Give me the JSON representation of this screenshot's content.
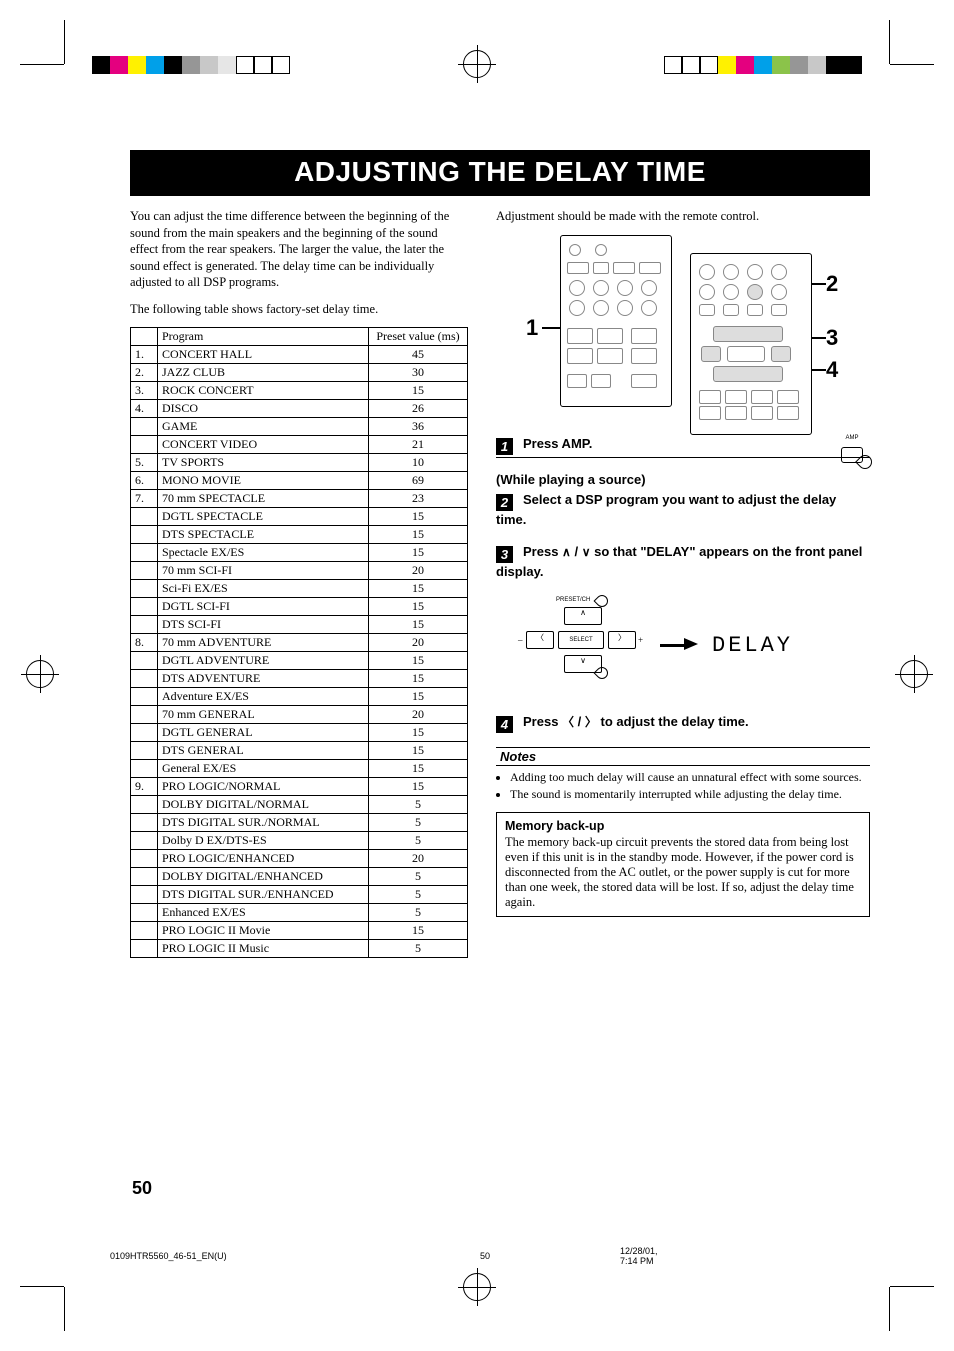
{
  "title": "ADJUSTING THE DELAY TIME",
  "intro1": "You can adjust the time difference between the beginning of the sound from the main speakers and the beginning of the sound effect from the rear speakers. The larger the value, the later the sound effect is generated. The delay time can be individually adjusted to all DSP programs.",
  "intro2": "The following table shows factory-set delay time.",
  "right_intro": "Adjustment should be made with the remote control.",
  "table": {
    "h_program": "Program",
    "h_value": "Preset value (ms)"
  },
  "rows": [
    {
      "n": "1.",
      "p": "CONCERT HALL",
      "v": "45"
    },
    {
      "n": "2.",
      "p": "JAZZ CLUB",
      "v": "30"
    },
    {
      "n": "3.",
      "p": "ROCK CONCERT",
      "v": "15"
    },
    {
      "n": "4.",
      "p": "DISCO",
      "v": "26"
    },
    {
      "n": "",
      "p": "GAME",
      "v": "36"
    },
    {
      "n": "",
      "p": "CONCERT VIDEO",
      "v": "21"
    },
    {
      "n": "5.",
      "p": "TV SPORTS",
      "v": "10"
    },
    {
      "n": "6.",
      "p": "MONO MOVIE",
      "v": "69"
    },
    {
      "n": "7.",
      "p": "70 mm SPECTACLE",
      "v": "23"
    },
    {
      "n": "",
      "p": "DGTL SPECTACLE",
      "v": "15"
    },
    {
      "n": "",
      "p": "DTS SPECTACLE",
      "v": "15"
    },
    {
      "n": "",
      "p": "Spectacle EX/ES",
      "v": "15"
    },
    {
      "n": "",
      "p": "70 mm SCI-FI",
      "v": "20"
    },
    {
      "n": "",
      "p": "Sci-Fi EX/ES",
      "v": "15"
    },
    {
      "n": "",
      "p": "DGTL SCI-FI",
      "v": "15"
    },
    {
      "n": "",
      "p": "DTS SCI-FI",
      "v": "15"
    },
    {
      "n": "8.",
      "p": "70 mm ADVENTURE",
      "v": "20"
    },
    {
      "n": "",
      "p": "DGTL ADVENTURE",
      "v": "15"
    },
    {
      "n": "",
      "p": "DTS ADVENTURE",
      "v": "15"
    },
    {
      "n": "",
      "p": "Adventure EX/ES",
      "v": "15"
    },
    {
      "n": "",
      "p": "70 mm GENERAL",
      "v": "20"
    },
    {
      "n": "",
      "p": "DGTL GENERAL",
      "v": "15"
    },
    {
      "n": "",
      "p": "DTS GENERAL",
      "v": "15"
    },
    {
      "n": "",
      "p": "General EX/ES",
      "v": "15"
    },
    {
      "n": "9.",
      "p": "PRO LOGIC/NORMAL",
      "v": "15"
    },
    {
      "n": "",
      "p": "DOLBY DIGITAL/NORMAL",
      "v": "5"
    },
    {
      "n": "",
      "p": "DTS DIGITAL SUR./NORMAL",
      "v": "5"
    },
    {
      "n": "",
      "p": "Dolby D EX/DTS-ES",
      "v": "5"
    },
    {
      "n": "",
      "p": "PRO LOGIC/ENHANCED",
      "v": "20"
    },
    {
      "n": "",
      "p": "DOLBY DIGITAL/ENHANCED",
      "v": "5"
    },
    {
      "n": "",
      "p": "DTS DIGITAL SUR./ENHANCED",
      "v": "5"
    },
    {
      "n": "",
      "p": "Enhanced EX/ES",
      "v": "5"
    },
    {
      "n": "",
      "p": "PRO LOGIC II Movie",
      "v": "15"
    },
    {
      "n": "",
      "p": "PRO LOGIC II Music",
      "v": "5"
    }
  ],
  "callouts": {
    "c1": "1",
    "c2": "2",
    "c3": "3",
    "c4": "4"
  },
  "steps": {
    "s1": "Press AMP.",
    "amp_label": "AMP",
    "while": "(While playing a source)",
    "s2": "Select a DSP program you want to adjust the delay time.",
    "s3a": "Press ",
    "s3b": " / ",
    "s3c": " so that \"DELAY\" appears on the front panel display.",
    "delay_word": "DELAY",
    "s4a": "Press ",
    "s4b": " / ",
    "s4c": " to adjust the delay time.",
    "dpad_label": "PRESET/CH",
    "dpad_select": "SELECT"
  },
  "notes_hd": "Notes",
  "notes": [
    "Adding too much delay will cause an unnatural effect with some sources.",
    "The sound is momentarily interrupted while adjusting the delay time."
  ],
  "memory": {
    "hd": "Memory back-up",
    "body": "The memory back-up circuit prevents the stored data from being lost even if this unit is in the standby mode. However, if the power cord is disconnected from the AC outlet, or the power supply is cut for more than one week, the stored data will be lost. If so, adjust the delay time again."
  },
  "page_number": "50",
  "footer": {
    "file": "0109HTR5560_46-51_EN(U)",
    "pg": "50",
    "ts": "12/28/01, 7:14 PM"
  },
  "colorbars": {
    "left": [
      "#000",
      "#e4007f",
      "#fff100",
      "#00a0e9",
      "#000",
      "#969696",
      "#c8c8c8",
      "#e6e6e6",
      "#fff",
      "#fff",
      "#fff"
    ],
    "right": [
      "#fff",
      "#fff",
      "#fff",
      "#fff100",
      "#e4007f",
      "#00a0e9",
      "#8bc34a",
      "#969696",
      "#c8c8c8",
      "#000",
      "#000"
    ]
  }
}
